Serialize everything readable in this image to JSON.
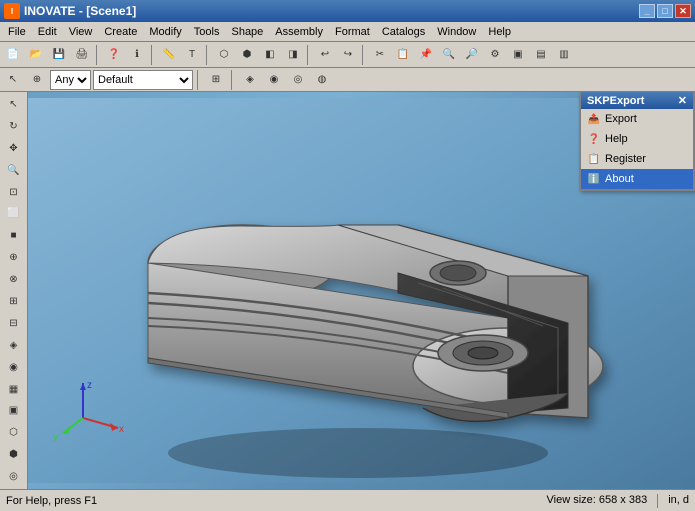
{
  "window": {
    "title": "INOVATE - [Scene1]",
    "logo_text": "I"
  },
  "menu": {
    "items": [
      "File",
      "Edit",
      "View",
      "Create",
      "Modify",
      "Tools",
      "Shape",
      "Assembly",
      "Format",
      "Catalogs",
      "Window",
      "Help"
    ]
  },
  "skp_panel": {
    "title": "SKPExport",
    "items": [
      {
        "label": "Export",
        "icon": "📤"
      },
      {
        "label": "Help",
        "icon": "❓"
      },
      {
        "label": "Register",
        "icon": "📋"
      },
      {
        "label": "About",
        "icon": "ℹ️"
      }
    ]
  },
  "toolbar2": {
    "any_label": "Any",
    "default_label": "Default"
  },
  "status": {
    "left": "For Help, press F1",
    "view_size": "View size: 658 x 383",
    "units": "in, d"
  },
  "axis": {
    "x_label": "x",
    "y_label": "y",
    "z_label": "z"
  }
}
